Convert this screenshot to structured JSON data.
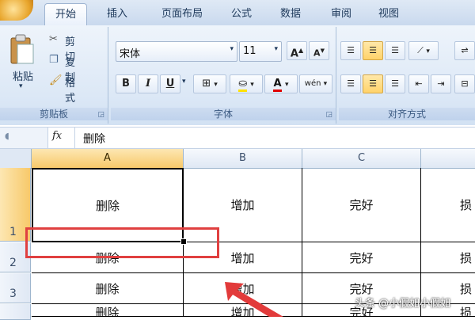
{
  "tabs": [
    "开始",
    "插入",
    "页面布局",
    "公式",
    "数据",
    "审阅",
    "视图"
  ],
  "clipboard": {
    "paste": "粘贴",
    "cut": "剪切",
    "copy": "复制",
    "format_painter": "格式刷",
    "group_label": "剪贴板"
  },
  "font": {
    "name": "宋体",
    "size": "11",
    "group_label": "字体",
    "bold": "B",
    "italic": "I",
    "underline": "U",
    "grow": "A",
    "shrink": "A",
    "color_a": "A",
    "phonetic": "wén"
  },
  "alignment": {
    "group_label": "对齐方式"
  },
  "formula_bar": {
    "fx": "fx",
    "content": "删除"
  },
  "columns": [
    "A",
    "B",
    "C",
    ""
  ],
  "rows": [
    "1",
    "2",
    "3",
    ""
  ],
  "cells": [
    [
      "删除",
      "增加",
      "完好",
      "损"
    ],
    [
      "删除",
      "增加",
      "完好",
      "损"
    ],
    [
      "删除",
      "增加",
      "完好",
      "损"
    ],
    [
      "删除",
      "增加",
      "完好",
      "损"
    ]
  ],
  "watermark": "头条 @小假如小假如",
  "colors": {
    "selection": "#f7c96a",
    "highlight_box": "#e04040",
    "arrow": "#e23b3b"
  }
}
